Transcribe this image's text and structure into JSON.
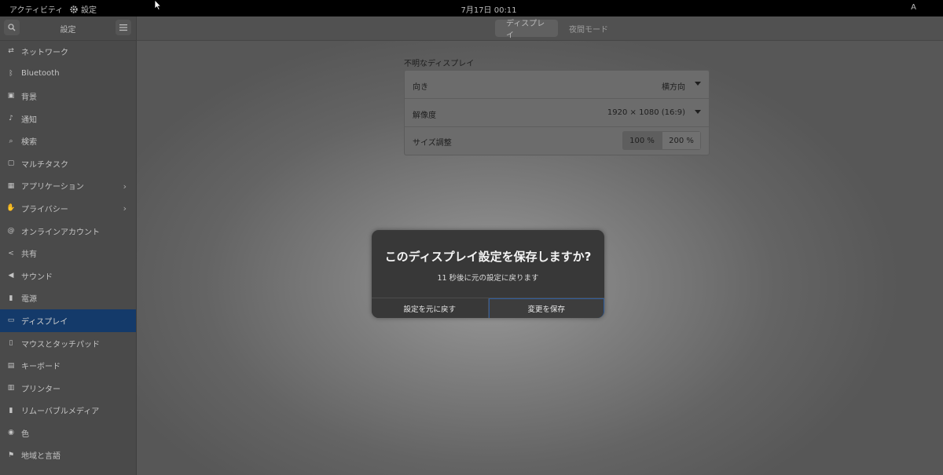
{
  "topbar": {
    "activities": "アクティビティ",
    "app_name": "設定",
    "clock": "7月17日  00:11",
    "input_method": "A"
  },
  "sidebar": {
    "title": "設定",
    "items": [
      {
        "label": "ネットワーク",
        "icon": "network-icon"
      },
      {
        "label": "Bluetooth",
        "icon": "bluetooth-icon"
      },
      {
        "label": "背景",
        "icon": "background-icon"
      },
      {
        "label": "通知",
        "icon": "bell-icon"
      },
      {
        "label": "検索",
        "icon": "search-icon"
      },
      {
        "label": "マルチタスク",
        "icon": "multitasking-icon"
      },
      {
        "label": "アプリケーション",
        "icon": "apps-icon",
        "chevron": true
      },
      {
        "label": "プライバシー",
        "icon": "hand-icon",
        "chevron": true
      },
      {
        "label": "オンラインアカウント",
        "icon": "at-icon"
      },
      {
        "label": "共有",
        "icon": "share-icon"
      },
      {
        "label": "サウンド",
        "icon": "speaker-icon"
      },
      {
        "label": "電源",
        "icon": "power-icon"
      },
      {
        "label": "ディスプレイ",
        "icon": "monitor-icon",
        "active": true
      },
      {
        "label": "マウスとタッチパッド",
        "icon": "mouse-icon"
      },
      {
        "label": "キーボード",
        "icon": "keyboard-icon"
      },
      {
        "label": "プリンター",
        "icon": "printer-icon"
      },
      {
        "label": "リムーバブルメディア",
        "icon": "usb-icon"
      },
      {
        "label": "色",
        "icon": "color-icon"
      },
      {
        "label": "地域と言語",
        "icon": "flag-icon"
      }
    ]
  },
  "header": {
    "tabs": [
      {
        "label": "ディスプレイ",
        "active": true
      },
      {
        "label": "夜間モード",
        "active": false
      }
    ]
  },
  "display": {
    "section_title": "不明なディスプレイ",
    "orientation_label": "向き",
    "orientation_value": "横方向",
    "resolution_label": "解像度",
    "resolution_value": "1920 × 1080 (16:9)",
    "scale_label": "サイズ調整",
    "scale_options": [
      "100 %",
      "200 %"
    ],
    "scale_selected": "100 %"
  },
  "dialog": {
    "title": "このディスプレイ設定を保存しますか?",
    "message": "11 秒後に元の設定に戻ります",
    "revert_label": "設定を元に戻す",
    "keep_label": "変更を保存"
  },
  "colors": {
    "selection": "#143a6a",
    "dialog_bg": "#383838"
  }
}
